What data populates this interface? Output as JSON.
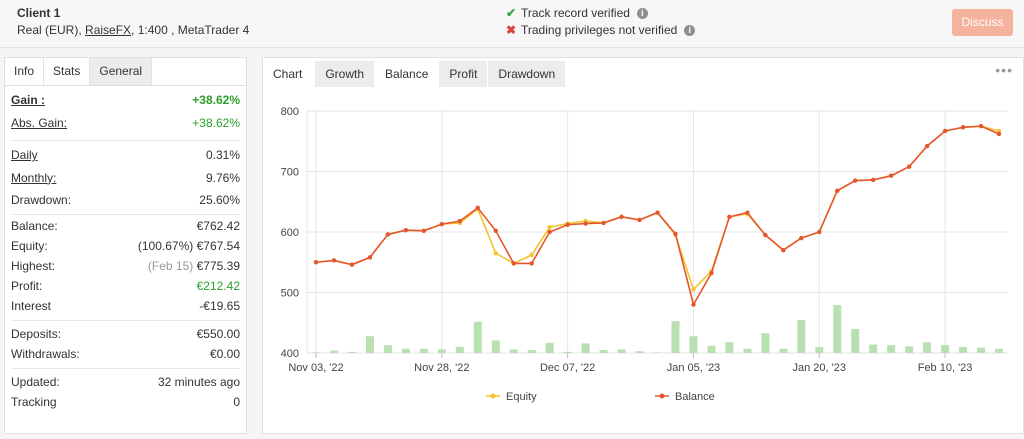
{
  "header": {
    "client_name": "Client 1",
    "account_type": "Real (EUR),",
    "broker": "RaiseFX",
    "leverage_platform": ", 1:400 , MetaTrader 4",
    "track_record": "Track record verified",
    "trading_privileges": "Trading privileges not verified",
    "discuss_label": "Discuss",
    "info_glyph": "i"
  },
  "left_tabs": [
    "Info",
    "Stats",
    "General"
  ],
  "stats": {
    "gain": {
      "label": "Gain :",
      "value": "+38.62%"
    },
    "abs_gain": {
      "label": "Abs. Gain:",
      "value": "+38.62%"
    },
    "daily": {
      "label": "Daily",
      "value": "0.31%"
    },
    "monthly": {
      "label": "Monthly:",
      "value": "9.76%"
    },
    "drawdown": {
      "label": "Drawdown:",
      "value": "25.60%"
    },
    "balance": {
      "label": "Balance:",
      "value": "€762.42"
    },
    "equity": {
      "label": "Equity:",
      "pct": "(100.67%)",
      "value": "€767.54"
    },
    "highest": {
      "label": "Highest:",
      "date": "(Feb 15)",
      "value": "€775.39"
    },
    "profit": {
      "label": "Profit:",
      "value": "€212.42"
    },
    "interest": {
      "label": "Interest",
      "value": "-€19.65"
    },
    "deposits": {
      "label": "Deposits:",
      "value": "€550.00"
    },
    "withdrawals": {
      "label": "Withdrawals:",
      "value": "€0.00"
    },
    "updated": {
      "label": "Updated:",
      "value": "32 minutes ago"
    },
    "tracking": {
      "label": "Tracking",
      "value": "0"
    }
  },
  "right_tabs": {
    "label": "Chart",
    "tabs": [
      "Growth",
      "Balance",
      "Profit",
      "Drawdown"
    ],
    "active": "Balance",
    "more_glyph": "•••"
  },
  "colors": {
    "balance": "#e4572e",
    "equity": "#f4c430",
    "volume": "#b9e0b0",
    "grid": "#e6e6e6"
  },
  "chart_data": {
    "type": "line",
    "ylim": [
      400,
      800
    ],
    "yticks": [
      400,
      500,
      600,
      700,
      800
    ],
    "xtick_labels": [
      "Nov 03, '22",
      "Nov 28, '22",
      "Dec 07, '22",
      "Jan 05, '23",
      "Jan 20, '23",
      "Feb 10, '23"
    ],
    "xtick_index": [
      0,
      7,
      14,
      21,
      28,
      35
    ],
    "series": [
      {
        "name": "Equity",
        "values": [
          550,
          553,
          546,
          558,
          596,
          603,
          602,
          613,
          615,
          638,
          565,
          548,
          562,
          608,
          614,
          618,
          615,
          625,
          620,
          632,
          595,
          505,
          535,
          625,
          630,
          595,
          570,
          590,
          600,
          668,
          685,
          686,
          693,
          708,
          742,
          767,
          773,
          775,
          767
        ]
      },
      {
        "name": "Balance",
        "values": [
          550,
          553,
          546,
          558,
          596,
          603,
          602,
          613,
          618,
          640,
          602,
          548,
          548,
          600,
          612,
          614,
          615,
          625,
          620,
          632,
          597,
          480,
          532,
          625,
          632,
          595,
          570,
          590,
          600,
          668,
          685,
          686,
          693,
          708,
          742,
          767,
          773,
          775,
          762
        ]
      }
    ],
    "volume": [
      1,
      4,
      2,
      28,
      13,
      7,
      7,
      6,
      10,
      52,
      21,
      6,
      5,
      17,
      2,
      16,
      5,
      6,
      3,
      1,
      53,
      28,
      12,
      18,
      7,
      33,
      7,
      55,
      10,
      80,
      40,
      14,
      13,
      11,
      18,
      13,
      10,
      9,
      7
    ]
  }
}
